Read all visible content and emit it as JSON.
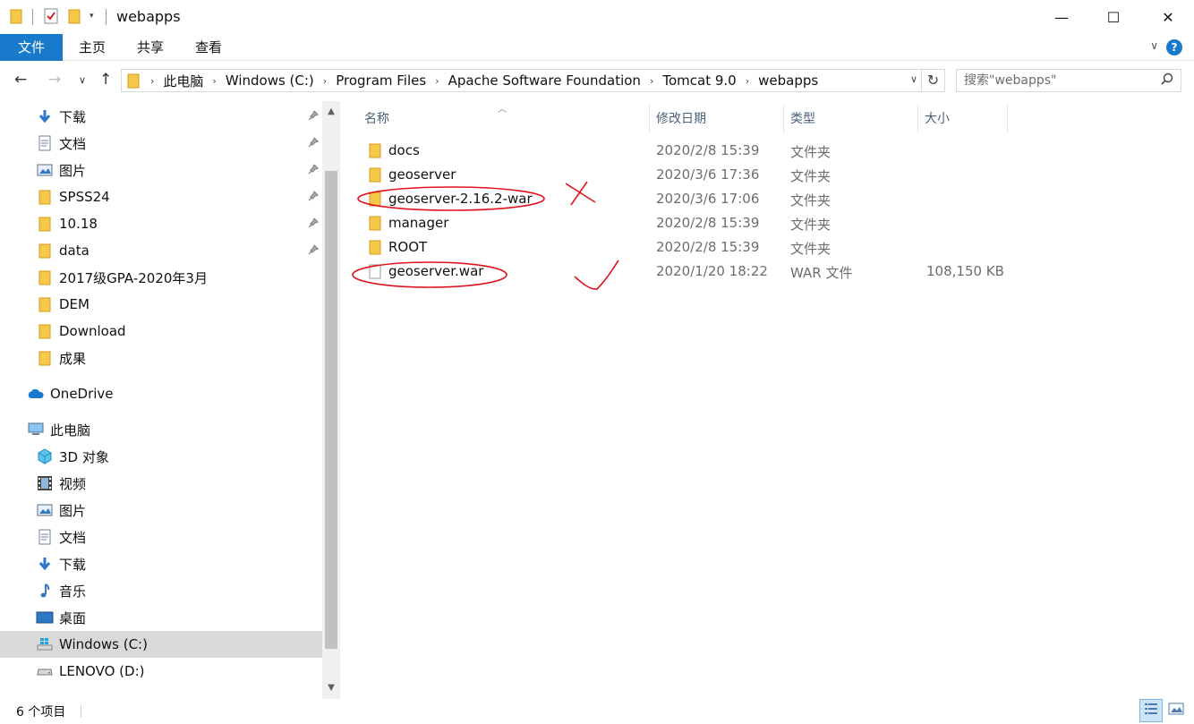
{
  "window": {
    "title": "webapps",
    "minimize_glyph": "—",
    "maximize_glyph": "☐",
    "close_glyph": "✕"
  },
  "ribbon": {
    "tabs": [
      "文件",
      "主页",
      "共享",
      "查看"
    ],
    "help_glyph": "?",
    "collapse_glyph": "∨"
  },
  "nav": {
    "back_glyph": "←",
    "forward_glyph": "→",
    "recent_glyph": "∨",
    "up_glyph": "↑",
    "breadcrumb": [
      "此电脑",
      "Windows (C:)",
      "Program Files",
      "Apache Software Foundation",
      "Tomcat 9.0",
      "webapps"
    ],
    "crumb_separator": "›",
    "dropdown_glyph": "∨",
    "refresh_glyph": "↻",
    "search_placeholder": "搜索\"webapps\""
  },
  "sidebar": {
    "quick_access": [
      {
        "label": "下载",
        "icon": "download-arrow-icon",
        "pinned": true
      },
      {
        "label": "文档",
        "icon": "document-icon",
        "pinned": true
      },
      {
        "label": "图片",
        "icon": "picture-icon",
        "pinned": true
      },
      {
        "label": "SPSS24",
        "icon": "folder-icon",
        "pinned": true
      },
      {
        "label": "10.18",
        "icon": "folder-icon",
        "pinned": true
      },
      {
        "label": "data",
        "icon": "folder-icon",
        "pinned": true
      },
      {
        "label": "2017级GPA-2020年3月",
        "icon": "folder-icon",
        "pinned": false
      },
      {
        "label": "DEM",
        "icon": "folder-icon",
        "pinned": false
      },
      {
        "label": "Download",
        "icon": "folder-icon",
        "pinned": false
      },
      {
        "label": "成果",
        "icon": "folder-icon",
        "pinned": false
      }
    ],
    "onedrive": "OneDrive",
    "this_pc": "此电脑",
    "pc_items": [
      {
        "label": "3D 对象",
        "icon": "3d-objects-icon"
      },
      {
        "label": "视频",
        "icon": "video-icon"
      },
      {
        "label": "图片",
        "icon": "picture-icon"
      },
      {
        "label": "文档",
        "icon": "document-icon"
      },
      {
        "label": "下载",
        "icon": "download-arrow-icon"
      },
      {
        "label": "音乐",
        "icon": "music-note-icon"
      },
      {
        "label": "桌面",
        "icon": "desktop-icon"
      },
      {
        "label": "Windows (C:)",
        "icon": "windows-drive-icon",
        "selected": true
      },
      {
        "label": "LENOVO (D:)",
        "icon": "drive-icon"
      }
    ],
    "pin_glyph": "📌"
  },
  "columns": {
    "name": "名称",
    "date": "修改日期",
    "type": "类型",
    "size": "大小"
  },
  "files": [
    {
      "name": "docs",
      "date": "2020/2/8 15:39",
      "type": "文件夹",
      "size": "",
      "kind": "folder"
    },
    {
      "name": "geoserver",
      "date": "2020/3/6 17:36",
      "type": "文件夹",
      "size": "",
      "kind": "folder"
    },
    {
      "name": "geoserver-2.16.2-war",
      "date": "2020/3/6 17:06",
      "type": "文件夹",
      "size": "",
      "kind": "folder",
      "annotation": "cross"
    },
    {
      "name": "manager",
      "date": "2020/2/8 15:39",
      "type": "文件夹",
      "size": "",
      "kind": "folder"
    },
    {
      "name": "ROOT",
      "date": "2020/2/8 15:39",
      "type": "文件夹",
      "size": "",
      "kind": "folder"
    },
    {
      "name": "geoserver.war",
      "date": "2020/1/20 18:22",
      "type": "WAR 文件",
      "size": "108,150 KB",
      "kind": "file",
      "annotation": "check"
    }
  ],
  "status": {
    "item_count": "6 个项目"
  },
  "colors": {
    "accent": "#1979ca",
    "annotation_red": "#e0141e",
    "folder_yellow": "#f7c94a",
    "selected_bg": "#d9d9d9"
  }
}
